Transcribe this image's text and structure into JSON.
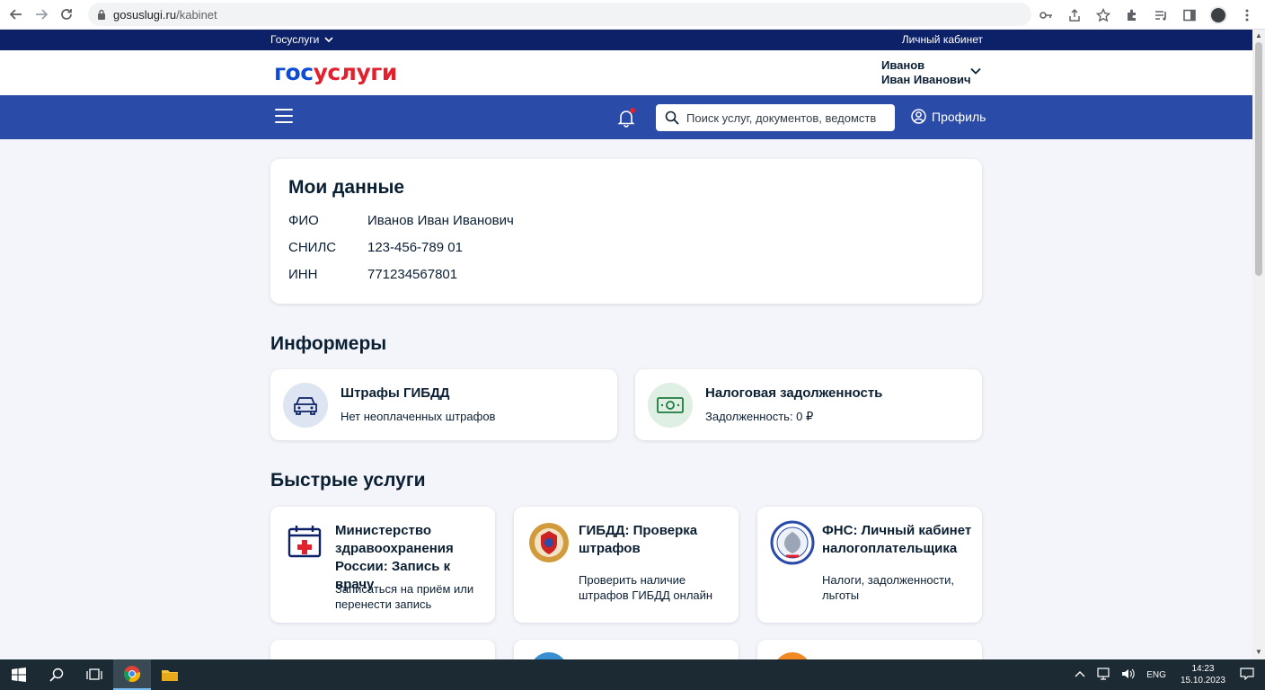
{
  "browser": {
    "url_host": "gosuslugi.ru",
    "url_path": "/kabinet"
  },
  "site_strip": {
    "left_label": "Госуслуги",
    "right_label": "Личный кабинет"
  },
  "header": {
    "logo_part1": "гос",
    "logo_part2": "услуги",
    "user_last_name": "Иванов",
    "user_first_middle": "Иван Иванович"
  },
  "navbar": {
    "search_placeholder": "Поиск услуг, документов, ведомств",
    "profile_label": "Профиль"
  },
  "my_data": {
    "title": "Мои данные",
    "rows": [
      {
        "key": "ФИО",
        "value": "Иванов Иван Иванович"
      },
      {
        "key": "СНИЛС",
        "value": "123-456-789 01"
      },
      {
        "key": "ИНН",
        "value": "771234567801"
      }
    ]
  },
  "informers": {
    "title": "Информеры",
    "items": [
      {
        "title": "Штрафы ГИБДД",
        "subtitle": "Нет неоплаченных штрафов"
      },
      {
        "title": "Налоговая задолженность",
        "subtitle": "Задолженность: 0 ₽"
      }
    ]
  },
  "quick_services": {
    "title": "Быстрые услуги",
    "items": [
      {
        "title": "Министерство здравоохранения России: Запись к врачу",
        "subtitle": "Записаться на приём или перенести запись"
      },
      {
        "title": "ГИБДД: Проверка штрафов",
        "subtitle": "Проверить наличие штрафов ГИБДД онлайн"
      },
      {
        "title": "ФНС: Личный кабинет налогоплательщика",
        "subtitle": "Налоги, задолженности, льготы"
      }
    ]
  },
  "taskbar": {
    "lang": "ENG",
    "time": "14:23",
    "date": "15.10.2023"
  },
  "colors": {
    "brand_blue": "#0d4cd3",
    "brand_red": "#e1222e",
    "nav_blue": "#2a4ba8",
    "strip_dark": "#0d2168"
  }
}
